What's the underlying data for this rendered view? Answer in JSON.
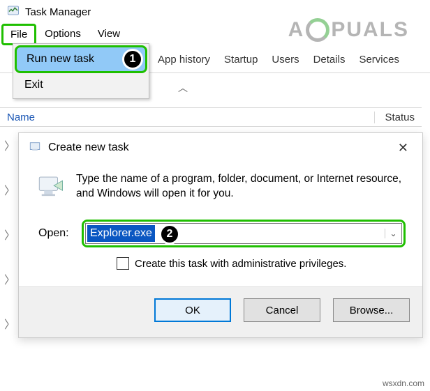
{
  "window": {
    "title": "Task Manager"
  },
  "menubar": {
    "file": "File",
    "options": "Options",
    "view": "View"
  },
  "file_menu": {
    "run_new_task": "Run new task",
    "exit": "Exit"
  },
  "tabs": {
    "app_history": "App history",
    "startup": "Startup",
    "users": "Users",
    "details": "Details",
    "services": "Services"
  },
  "list_header": {
    "name": "Name",
    "status": "Status"
  },
  "dialog": {
    "title": "Create new task",
    "instruction": "Type the name of a program, folder, document, or Internet resource, and Windows will open it for you.",
    "open_label": "Open:",
    "open_value": "Explorer.exe",
    "admin_checkbox_label": "Create this task with administrative privileges.",
    "buttons": {
      "ok": "OK",
      "cancel": "Cancel",
      "browse": "Browse..."
    }
  },
  "markers": {
    "one": "1",
    "two": "2"
  },
  "watermark": {
    "left": "A",
    "right": "PUALS"
  },
  "credit": "wsxdn.com"
}
